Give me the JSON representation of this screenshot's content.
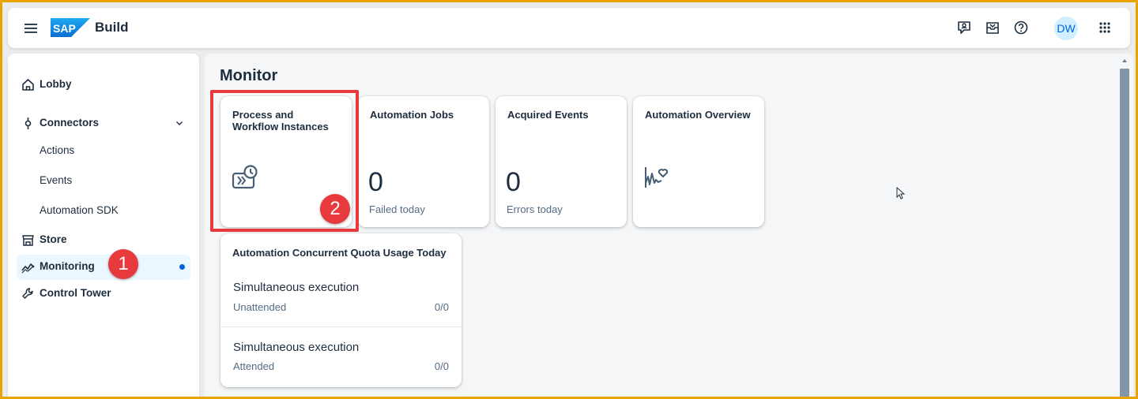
{
  "header": {
    "logo": "SAP",
    "product": "Build",
    "icons": [
      "feedback-icon",
      "inbox-icon",
      "help-icon",
      "app-launcher-icon"
    ],
    "avatar_initials": "DW"
  },
  "sidebar": {
    "items": [
      {
        "label": "Lobby",
        "icon": "home-icon"
      },
      {
        "label": "Connectors",
        "icon": "connector-icon",
        "expanded": true,
        "children": [
          {
            "label": "Actions"
          },
          {
            "label": "Events"
          },
          {
            "label": "Automation SDK"
          }
        ]
      },
      {
        "label": "Store",
        "icon": "store-icon"
      },
      {
        "label": "Monitoring",
        "icon": "monitoring-icon",
        "selected": true
      },
      {
        "label": "Control Tower",
        "icon": "wrench-icon"
      }
    ]
  },
  "main": {
    "title": "Monitor",
    "tiles": [
      {
        "title": "Process and Workflow Instances",
        "icon": "process-instances-icon"
      },
      {
        "title": "Automation Jobs",
        "kpi": "0",
        "footer": "Failed today"
      },
      {
        "title": "Acquired Events",
        "kpi": "0",
        "footer": "Errors today"
      },
      {
        "title": "Automation Overview",
        "icon": "heart-chart-icon"
      }
    ],
    "quota": {
      "title": "Automation Concurrent Quota Usage Today",
      "rows": [
        {
          "title": "Simultaneous execution",
          "sub": "Unattended",
          "value": "0/0"
        },
        {
          "title": "Simultaneous execution",
          "sub": "Attended",
          "value": "0/0"
        }
      ]
    }
  },
  "annotations": {
    "badge1": "1",
    "badge2": "2",
    "color": "#e8393d"
  },
  "colors": {
    "accent": "#0064d9",
    "frame": "#e9a400",
    "selected_bg": "#ebf8ff"
  }
}
